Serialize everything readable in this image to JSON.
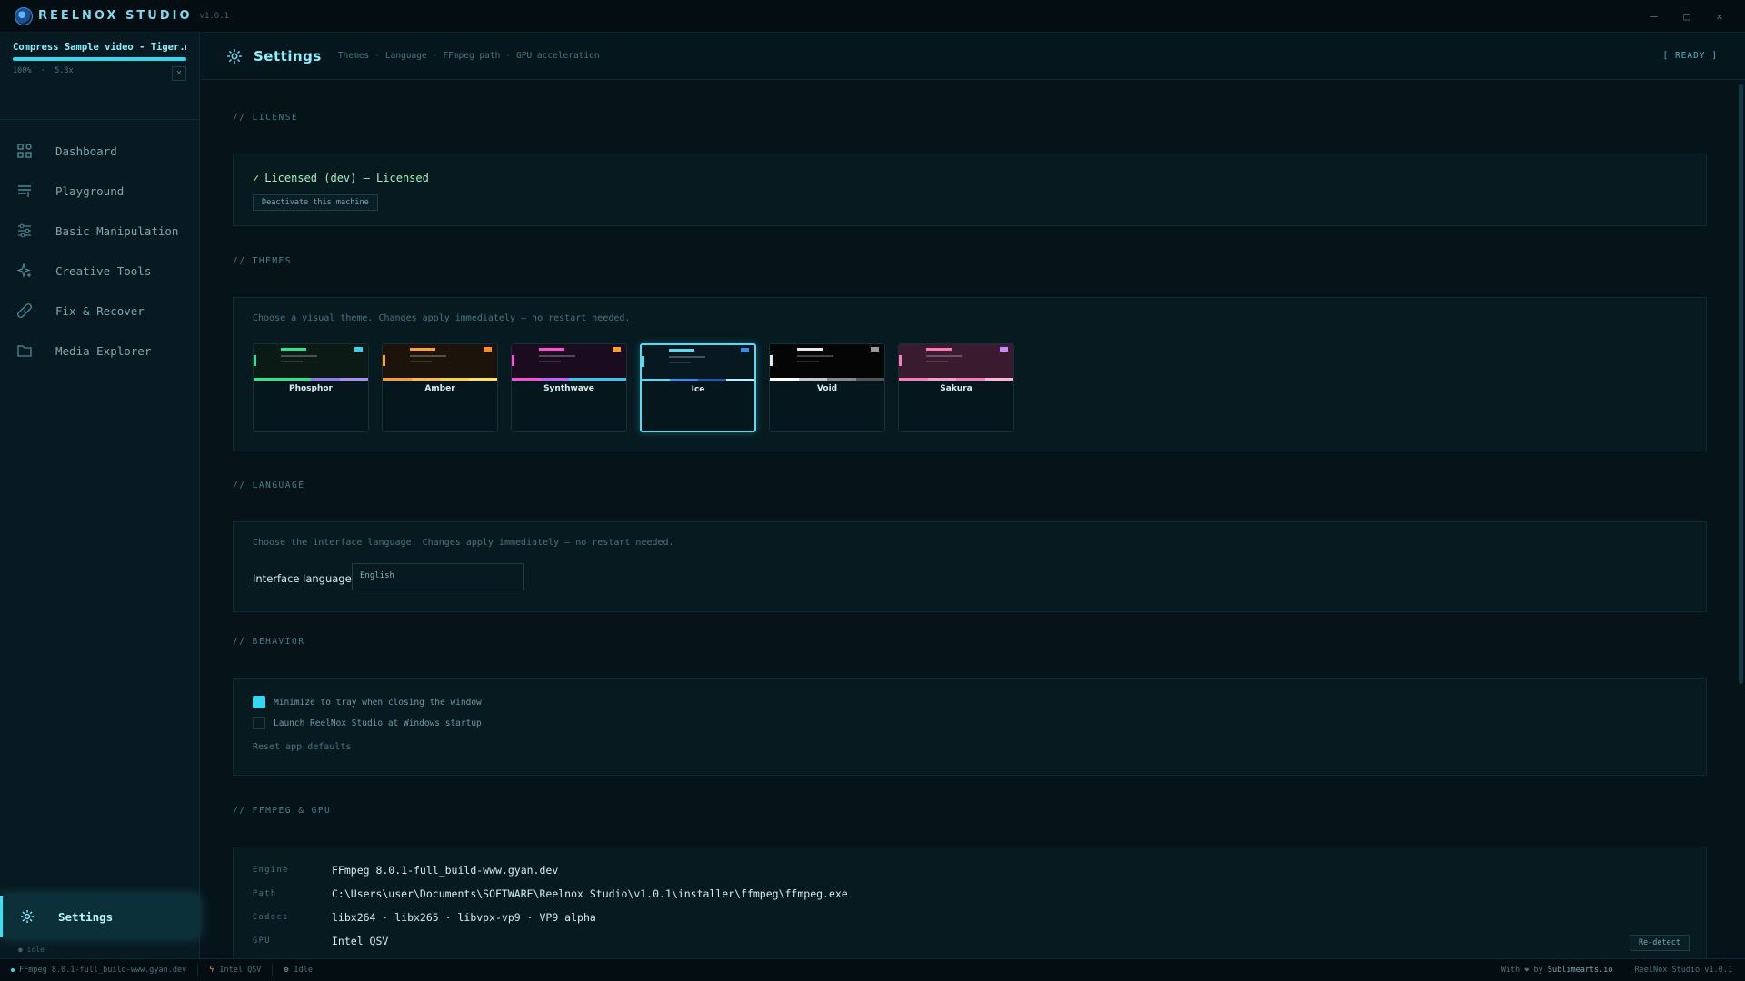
{
  "app": {
    "title": "REELNOX STUDIO",
    "version": "v1.0.1",
    "window_controls": [
      "–",
      "□",
      "✕"
    ]
  },
  "job": {
    "title": "Compress Sample video - Tiger.mp",
    "progress_percent": 100,
    "percent_text": "100%",
    "speed_text": "5.3x",
    "close_label": "✕"
  },
  "sidebar": {
    "items": [
      {
        "label": "Dashboard",
        "icon": "grid-icon"
      },
      {
        "label": "Playground",
        "icon": "lines-icon"
      },
      {
        "label": "Basic Manipulation",
        "icon": "sliders-icon"
      },
      {
        "label": "Creative Tools",
        "icon": "sparkle-icon"
      },
      {
        "label": "Fix & Recover",
        "icon": "bandage-icon"
      },
      {
        "label": "Media Explorer",
        "icon": "folder-icon"
      }
    ],
    "settings_label": "Settings",
    "idle_text": "● idle"
  },
  "header": {
    "title": "Settings",
    "breadcrumbs": [
      "Themes",
      "Language",
      "FFmpeg path",
      "GPU acceleration"
    ],
    "status": "[ READY ]"
  },
  "license": {
    "heading": "// LICENSE",
    "status": "Licensed (dev) — Licensed",
    "check_glyph": "✓",
    "deactivate_label": "Deactivate this machine"
  },
  "themes": {
    "heading": "// THEMES",
    "hint": "Choose a visual theme. Changes apply immediately — no restart needed.",
    "selected": "Ice",
    "items": [
      {
        "name": "Phosphor",
        "bg": "#0b1a14",
        "accent": "#2ee38e",
        "accent2": "#3ad0f0",
        "stripe": [
          "#2ee38e",
          "#2ee38e",
          "#8f7cf0",
          "#a98df8"
        ]
      },
      {
        "name": "Amber",
        "bg": "#1c140a",
        "accent": "#ffa23a",
        "accent2": "#ff8a2a",
        "stripe": [
          "#ff9a3a",
          "#ffb84a",
          "#ffd040",
          "#ffe060"
        ]
      },
      {
        "name": "Synthwave",
        "bg": "#1a0b1e",
        "accent": "#ff4fd8",
        "accent2": "#ff9f2a",
        "stripe": [
          "#ff4fd8",
          "#c060ff",
          "#36c6f0",
          "#36c6f0"
        ]
      },
      {
        "name": "Ice",
        "bg": "#071820",
        "accent": "#5fd8ef",
        "accent2": "#3a8cf0",
        "stripe": [
          "#5fd8ef",
          "#3a8cf0",
          "#1e5ab0",
          "#bfefff"
        ]
      },
      {
        "name": "Void",
        "bg": "#050505",
        "accent": "#e8e8e8",
        "accent2": "#9a9a9a",
        "stripe": [
          "#ffffff",
          "#c8c8c8",
          "#888888",
          "#555555"
        ]
      },
      {
        "name": "Sakura",
        "bg": "#3a1a2e",
        "accent": "#ff7ab8",
        "accent2": "#c68cff",
        "stripe": [
          "#ff7ab8",
          "#ff9acb",
          "#ff7ab8",
          "#ffb3d6"
        ]
      }
    ]
  },
  "language": {
    "heading": "// LANGUAGE",
    "hint": "Choose the interface language. Changes apply immediately — no restart needed.",
    "label": "Interface language",
    "value": "English"
  },
  "behavior": {
    "heading": "// BEHAVIOR",
    "minimize_label": "Minimize to tray when closing the window",
    "minimize_checked": true,
    "launch_label": "Launch ReelNox Studio at Windows startup",
    "launch_checked": false,
    "reset_label": "Reset app defaults"
  },
  "ffmpeg": {
    "heading": "// FFMPEG & GPU",
    "engine_key": "Engine",
    "engine": "FFmpeg 8.0.1-full_build-www.gyan.dev",
    "path_key": "Path",
    "path": "C:\\Users\\user\\Documents\\SOFTWARE\\Reelnox Studio\\v1.0.1\\installer\\ffmpeg\\ffmpeg.exe",
    "codecs_key": "Codecs",
    "codecs": "libx264 · libx265 · libvpx-vp9 · VP9 alpha",
    "gpu_key": "GPU",
    "gpu": "Intel QSV",
    "redetect_label": "Re-detect"
  },
  "statusbar": {
    "ffmpeg": "FFmpeg 8.0.1-full_build-www.gyan.dev",
    "gpu": "Intel QSV",
    "state": "Idle",
    "credit_prefix": "With ❤ by",
    "credit_name": "Sublimearts.io",
    "app_version": "ReelNox Studio v1.0.1"
  },
  "colors": {
    "accent": "#35d6f0",
    "background": "#06141a",
    "sidebar": "#071a21"
  }
}
